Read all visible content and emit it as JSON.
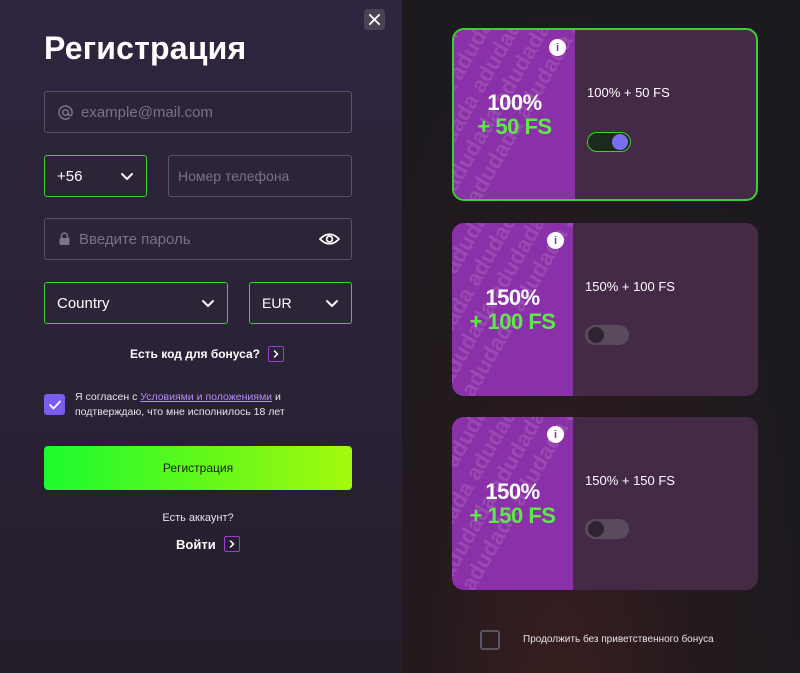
{
  "form": {
    "title": "Регистрация",
    "email_placeholder": "example@mail.com",
    "phone_code": "+56",
    "phone_placeholder": "Номер телефона",
    "password_placeholder": "Введите пароль",
    "country_value": "Country",
    "currency_value": "EUR",
    "bonus_code_label": "Есть код для бонуса?",
    "agree_prefix": "Я согласен с ",
    "agree_terms_link": "Условиями и положениями",
    "agree_suffix": " и подтверждаю, что мне исполнилось 18 лет",
    "agree_checked": true,
    "register_button": "Регистрация",
    "has_account": "Есть аккаунт?",
    "login_label": "Войти"
  },
  "bonuses": [
    {
      "percent": "100%",
      "fs": "+ 50 FS",
      "label": "100% + 50 FS",
      "selected": true
    },
    {
      "percent": "150%",
      "fs": "+ 100 FS",
      "label": "150% + 100 FS",
      "selected": false
    },
    {
      "percent": "150%",
      "fs": "+ 150 FS",
      "label": "150% + 150 FS",
      "selected": false
    }
  ],
  "skip_bonus_label": "Продолжить без приветственного бонуса",
  "colors": {
    "accent_green": "#3ad22f",
    "promo_purple": "#8a30a8",
    "checkbox_purple": "#7a5cf0"
  }
}
